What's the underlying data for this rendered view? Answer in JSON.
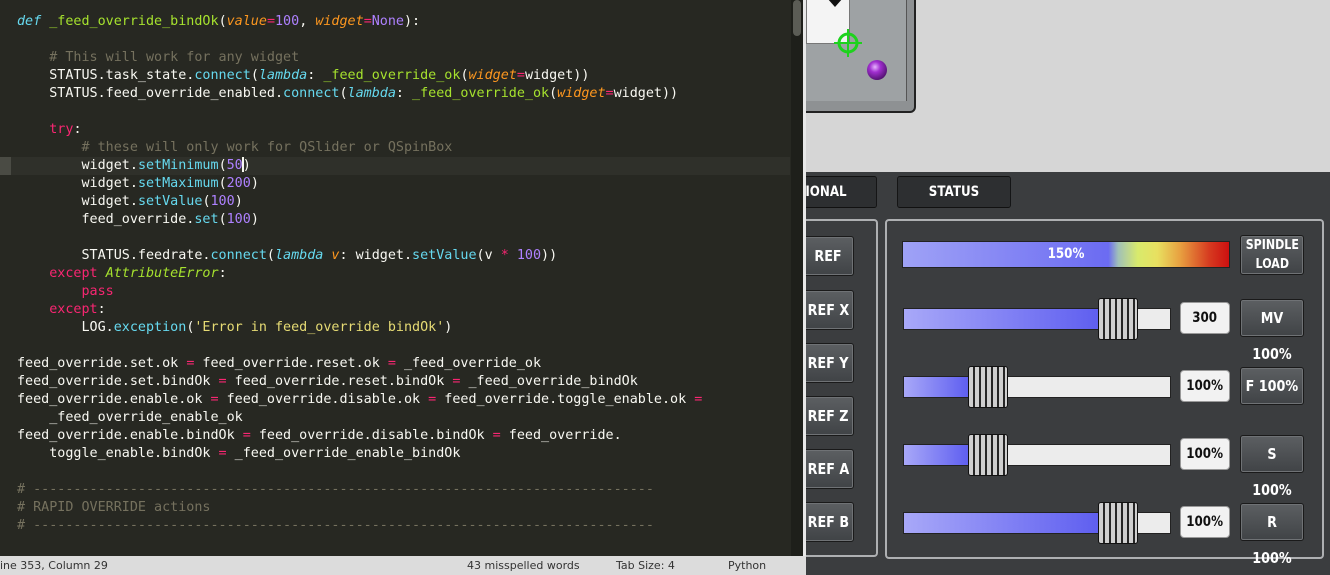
{
  "editor": {
    "statusbar": {
      "position": "ine 353, Column 29",
      "spelling": "43 misspelled words",
      "tab_size": "Tab Size: 4",
      "syntax": "Python"
    }
  },
  "machine_panel": {
    "tabs": [
      "IONAL",
      "STATUS"
    ],
    "ref_buttons": [
      "REF",
      "REF X",
      "REF Y",
      "REF Z",
      "REF A",
      "REF B"
    ],
    "spindle_load": {
      "value_text": "150%",
      "level": 150,
      "button_label": "SPINDLE\nLOAD"
    },
    "overrides": [
      {
        "id": "max-velocity",
        "value": "300",
        "button": "MV 100%",
        "fill": 0.85
      },
      {
        "id": "feed",
        "value": "100%",
        "button": "F 100%",
        "fill": 0.28
      },
      {
        "id": "spindle",
        "value": "100%",
        "button": "S 100%",
        "fill": 0.28
      },
      {
        "id": "rapid",
        "value": "100%",
        "button": "R 100%",
        "fill": 0.85
      }
    ]
  },
  "colors": {
    "editor_bg": "#272822",
    "keyword": "#f92672",
    "storage": "#66d9ef",
    "function": "#a6e22e",
    "number": "#ae81ff",
    "string": "#e6db74",
    "comment": "#75715e",
    "panel_bg": "#3b3d3f",
    "slider_fill": "#5f5ff0"
  },
  "icons": [
    "crosshair-icon",
    "tool-sphere-icon",
    "tool-pointer-icon"
  ]
}
